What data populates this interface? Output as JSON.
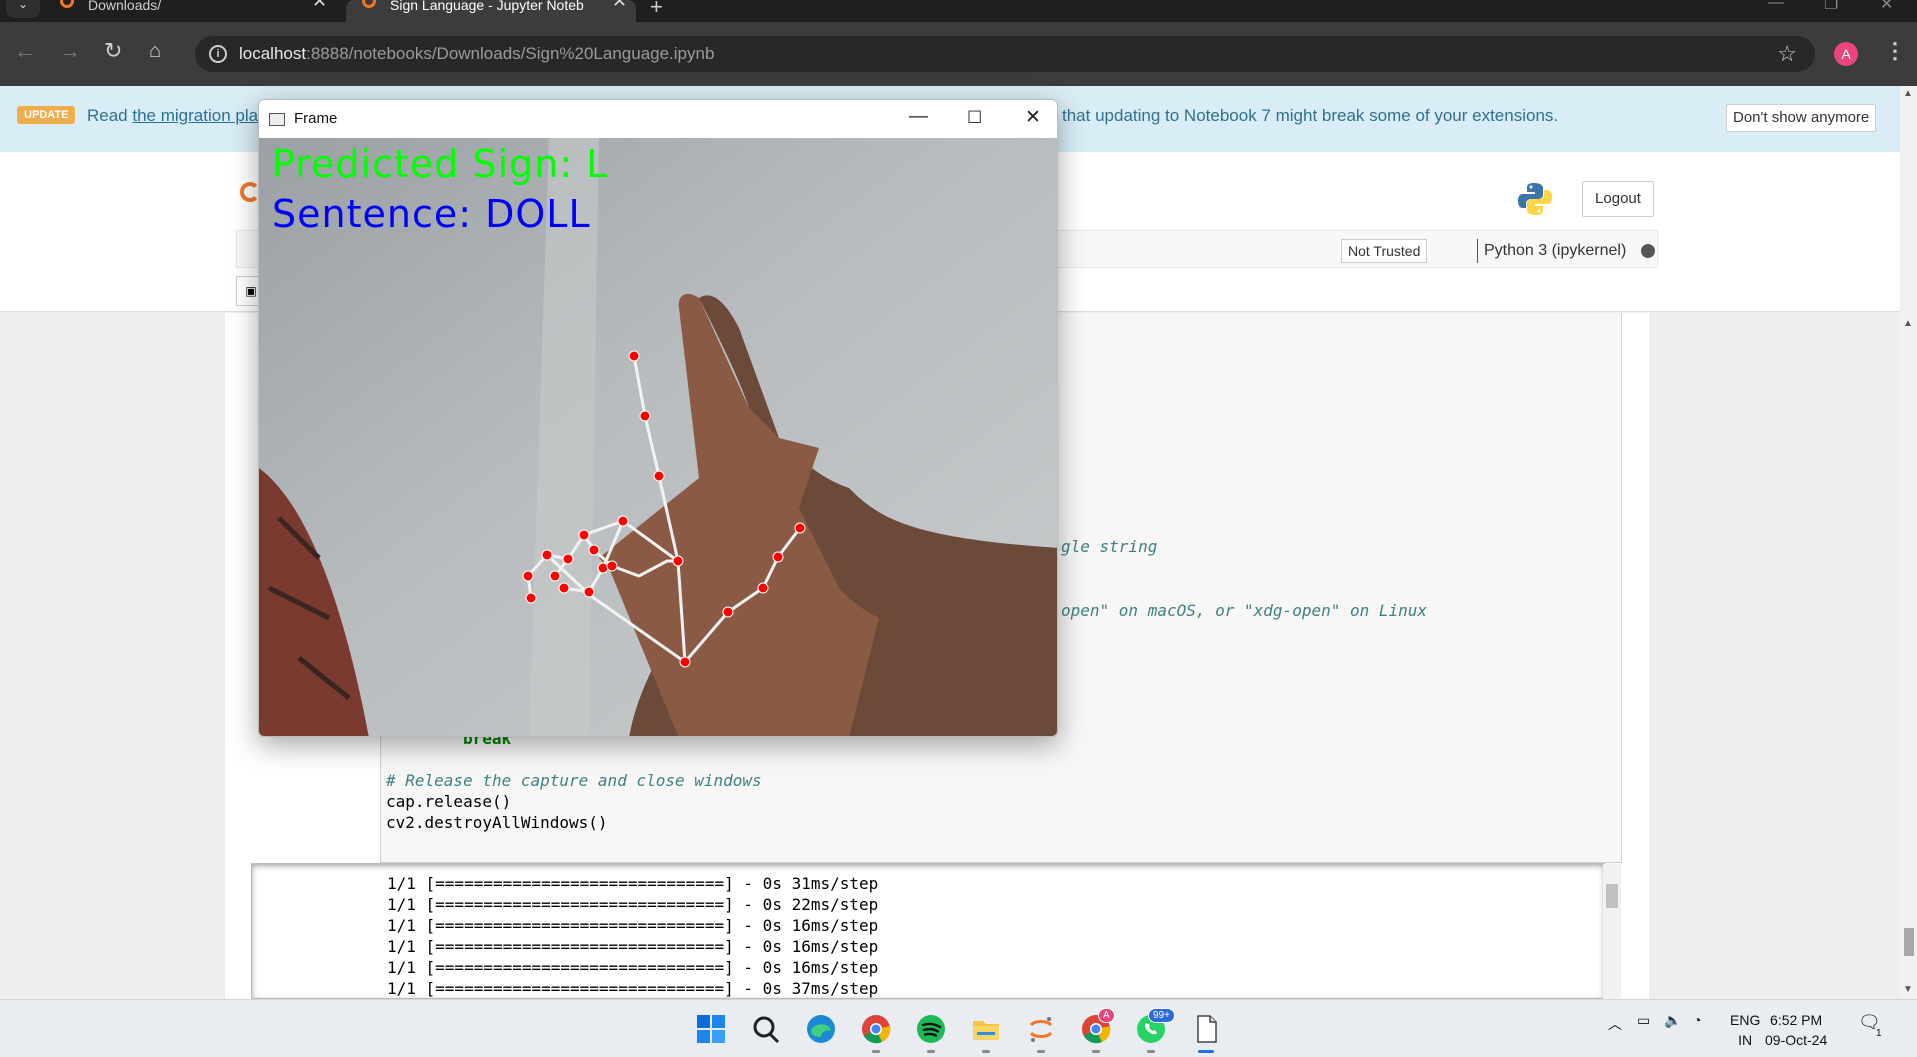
{
  "browser": {
    "tabs": [
      {
        "title": "Downloads/",
        "active": false
      },
      {
        "title": "Sign Language - Jupyter Noteb",
        "active": true
      }
    ],
    "url_host": "localhost",
    "url_path": ":8888/notebooks/Downloads/Sign%20Language.ipynb",
    "profile_initial": "A"
  },
  "update_banner": {
    "badge": "UPDATE",
    "text_prefix": "Read",
    "link": "the migration plan",
    "text_suffix": "that updating to Notebook 7 might break some of your extensions.",
    "dismiss_label": "Don't show anymore"
  },
  "header": {
    "logout_label": "Logout"
  },
  "menubar": {
    "trust_label": "Not Trusted",
    "kernel_label": "Python 3 (ipykernel)"
  },
  "code_cell": {
    "fragment_1": "gle string",
    "fragment_2": "open\" on macOS, or \"xdg-open\" on Linux",
    "break_kw": "break",
    "comment": "# Release the capture and close windows",
    "line_release": "cap.release()",
    "line_destroy": "cv2.destroyAllWindows()"
  },
  "output_lines": [
    "1/1 [==============================] - 0s 31ms/step",
    "1/1 [==============================] - 0s 22ms/step",
    "1/1 [==============================] - 0s 16ms/step",
    "1/1 [==============================] - 0s 16ms/step",
    "1/1 [==============================] - 0s 16ms/step",
    "1/1 [==============================] - 0s 37ms/step"
  ],
  "frame_window": {
    "title": "Frame",
    "predicted_sign": "Predicted Sign: L",
    "sentence": "Sentence: DOLL",
    "predicted_color": "#00ff00",
    "sentence_color": "#0000ff"
  },
  "taskbar": {
    "language_line1": "ENG",
    "language_line2": "IN",
    "time": "6:52 PM",
    "date": "09-Oct-24",
    "whatsapp_badge": "99+",
    "notification_count": "1"
  }
}
